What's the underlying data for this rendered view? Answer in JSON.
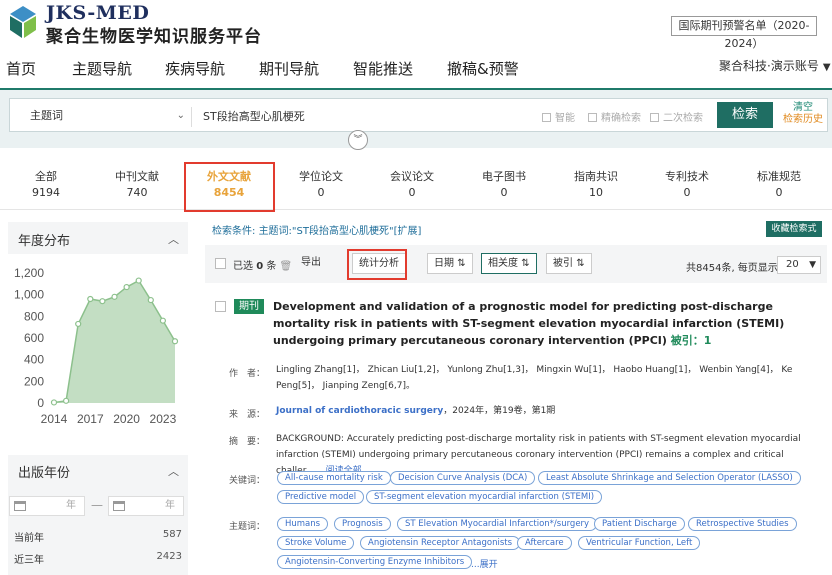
{
  "brand": {
    "name_en": "JKS-MED",
    "name_cn": "聚合生物医学知识服务平台"
  },
  "header": {
    "warning_list": "国际期刊预警名单（2020-2024）",
    "account": "聚合科技·演示账号"
  },
  "nav": [
    "首页",
    "主题导航",
    "疾病导航",
    "期刊导航",
    "智能推送",
    "撤稿&预警"
  ],
  "search": {
    "field": "主题词",
    "query": "ST段抬高型心肌梗死",
    "options": [
      "智能",
      "精确检索",
      "二次检索"
    ],
    "button": "检索",
    "clear": "清空",
    "history": "检索历史"
  },
  "tabs": [
    {
      "label": "全部",
      "count": "9194"
    },
    {
      "label": "中刊文献",
      "count": "740"
    },
    {
      "label": "外文文献",
      "count": "8454"
    },
    {
      "label": "学位论文",
      "count": "0"
    },
    {
      "label": "会议论文",
      "count": "0"
    },
    {
      "label": "电子图书",
      "count": "0"
    },
    {
      "label": "指南共识",
      "count": "10"
    },
    {
      "label": "专利技术",
      "count": "0"
    },
    {
      "label": "标准规范",
      "count": "0"
    }
  ],
  "sidebar": {
    "year_title": "年度分布",
    "pub_title": "出版年份",
    "year_placeholder": "年",
    "dash": "—",
    "pub_rows": [
      {
        "label": "当前年",
        "value": "587"
      },
      {
        "label": "近三年",
        "value": "2423"
      }
    ]
  },
  "chart_data": {
    "type": "area",
    "title": "",
    "xlabel": "",
    "ylabel": "",
    "xlim": [
      2014,
      2024
    ],
    "ylim": [
      0,
      1200
    ],
    "yticks": [
      "0",
      "200",
      "400",
      "600",
      "800",
      "1,000",
      "1,200"
    ],
    "xticks": [
      "2014",
      "2017",
      "2020",
      "2023"
    ],
    "x": [
      2014,
      2015,
      2016,
      2017,
      2018,
      2019,
      2020,
      2021,
      2022,
      2023,
      2024
    ],
    "values": [
      5,
      20,
      730,
      960,
      940,
      980,
      1070,
      1130,
      950,
      760,
      570
    ],
    "color": "#b8d8b8",
    "line_color": "#8cc08c"
  },
  "results": {
    "condition_label": "检索条件:",
    "condition": "主题词:\"ST段抬高型心肌梗死\"[扩展]",
    "save": "收藏检索式",
    "selected": "已选",
    "selected_count": "0",
    "selected_unit": "条",
    "export": "导出",
    "stats": "统计分析",
    "sort_date": "日期",
    "sort_relevance": "相关度",
    "sort_cited": "被引",
    "total": "共8454条, 每页显示",
    "page_size": "20"
  },
  "record": {
    "tag": "期刊",
    "title": "Development and validation of a prognostic model for predicting post-discharge mortality risk in patients with ST-segment elevation myocardial infarction (STEMI) undergoing primary percutaneous coronary intervention (PPCI)",
    "cited_label": "被引：",
    "cited": "1",
    "author_label": "作　者：",
    "authors": "Lingling Zhang[1]， Zhican Liu[1,2]， Yunlong Zhu[1,3]， Mingxin Wu[1]， Haobo Huang[1]， Wenbin Yang[4]， Ke Peng[5]， Jianping Zeng[6,7]。",
    "source_label": "来　源：",
    "journal": "Journal of cardiothoracic surgery",
    "source_rest": "，2024年，第19卷，第1期",
    "abstract_label": "摘　要：",
    "abstract": "BACKGROUND: Accurately predicting post-discharge mortality risk in patients with ST-segment elevation myocardial infarction (STEMI) undergoing primary percutaneous coronary intervention (PPCI) remains a complex and critical challer......",
    "read_all": "阅读全部",
    "keywords_label": "关键词：",
    "keywords": [
      "All-cause mortality risk",
      "Decision Curve Analysis (DCA)",
      "Least Absolute Shrinkage and Selection Operator (LASSO)",
      "Predictive model",
      "ST-segment elevation myocardial infarction (STEMI)"
    ],
    "subjects_label": "主题词：",
    "subjects": [
      "Humans",
      "Prognosis",
      "ST Elevation Myocardial Infarction*/surgery",
      "Patient Discharge",
      "Retrospective Studies",
      "Stroke Volume",
      "Angiotensin Receptor Antagonists",
      "Aftercare",
      "Ventricular Function, Left",
      "Angiotensin-Converting Enzyme Inhibitors"
    ],
    "expand": "...展开"
  }
}
